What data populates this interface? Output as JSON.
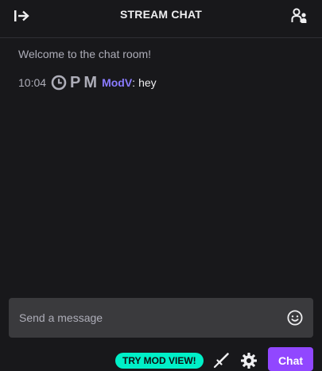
{
  "header": {
    "title": "STREAM CHAT",
    "collapse_icon": "collapse-arrow-icon",
    "users_icon": "community-users-icon"
  },
  "chat": {
    "welcome": "Welcome to the chat room!",
    "messages": [
      {
        "timestamp": "10:04",
        "badges": [
          {
            "type": "icon",
            "name": "clock-icon"
          },
          {
            "type": "letter",
            "text": "P"
          },
          {
            "type": "letter",
            "text": "M"
          }
        ],
        "username": "ModV",
        "separator": ":",
        "text": "hey"
      }
    ]
  },
  "input": {
    "placeholder": "Send a message",
    "value": "",
    "emote_icon": "smiley-icon"
  },
  "footer": {
    "mod_view_label": "TRY MOD VIEW!",
    "sword_icon": "sword-icon",
    "settings_icon": "gear-icon",
    "chat_button_label": "Chat"
  },
  "colors": {
    "background": "#18181b",
    "input_background": "#3a3a3d",
    "username": "#8a7bff",
    "mod_view_pill": "#00f0c8",
    "chat_button": "#9147ff",
    "muted_text": "#adadb8",
    "text": "#efeff1"
  }
}
